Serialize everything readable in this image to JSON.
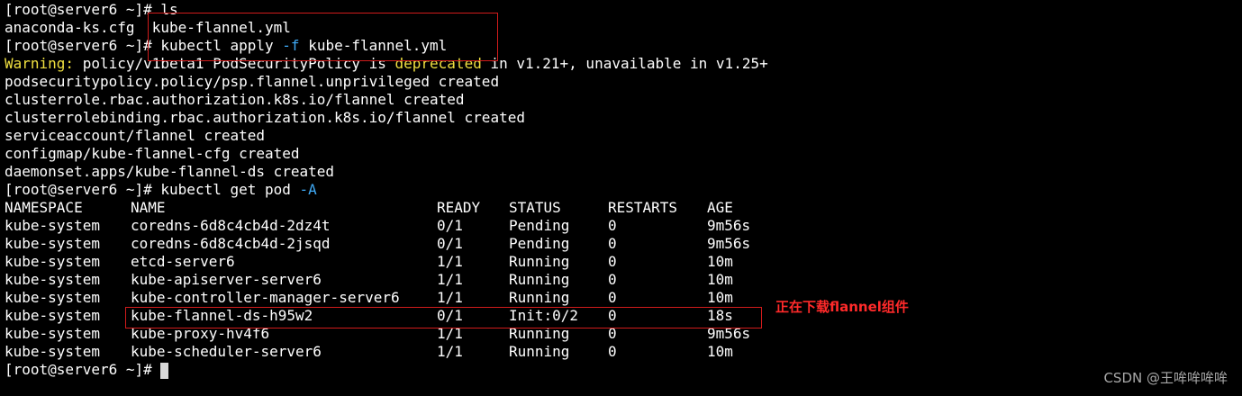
{
  "prompt": "[root@server6 ~]#",
  "commands": {
    "ls": "ls",
    "apply": "kubectl apply",
    "apply_flag": "-f",
    "apply_file": "kube-flannel.yml",
    "get": "kubectl get pod",
    "get_flag": "-A"
  },
  "ls_output": {
    "file1": "anaconda-ks.cfg",
    "file2": "kube-flannel.yml"
  },
  "warning": {
    "label": "Warning:",
    "text_before": "policy/v1beta1 PodSecurityPolicy is",
    "keyword": "deprecated",
    "text_after": "in v1.21+, unavailable in v1.25+"
  },
  "apply_output": [
    "podsecuritypolicy.policy/psp.flannel.unprivileged created",
    "clusterrole.rbac.authorization.k8s.io/flannel created",
    "clusterrolebinding.rbac.authorization.k8s.io/flannel created",
    "serviceaccount/flannel created",
    "configmap/kube-flannel-cfg created",
    "daemonset.apps/kube-flannel-ds created"
  ],
  "pods_table": {
    "headers": [
      "NAMESPACE",
      "NAME",
      "READY",
      "STATUS",
      "RESTARTS",
      "AGE"
    ],
    "rows": [
      [
        "kube-system",
        "coredns-6d8c4cb4d-2dz4t",
        "0/1",
        "Pending",
        "0",
        "9m56s"
      ],
      [
        "kube-system",
        "coredns-6d8c4cb4d-2jsqd",
        "0/1",
        "Pending",
        "0",
        "9m56s"
      ],
      [
        "kube-system",
        "etcd-server6",
        "1/1",
        "Running",
        "0",
        "10m"
      ],
      [
        "kube-system",
        "kube-apiserver-server6",
        "1/1",
        "Running",
        "0",
        "10m"
      ],
      [
        "kube-system",
        "kube-controller-manager-server6",
        "1/1",
        "Running",
        "0",
        "10m"
      ],
      [
        "kube-system",
        "kube-flannel-ds-h95w2",
        "0/1",
        "Init:0/2",
        "0",
        "18s"
      ],
      [
        "kube-system",
        "kube-proxy-hv4f6",
        "1/1",
        "Running",
        "0",
        "9m56s"
      ],
      [
        "kube-system",
        "kube-scheduler-server6",
        "1/1",
        "Running",
        "0",
        "10m"
      ]
    ]
  },
  "annotation": "正在下载flannel组件",
  "watermark": "CSDN @王哞哞哞哞",
  "colors": {
    "background": "#000000",
    "text": "#ffffff",
    "warning": "#f0e040",
    "flag": "#3fa9f5",
    "highlight_box": "#d11b1b",
    "annotation": "#ff2a2a"
  }
}
